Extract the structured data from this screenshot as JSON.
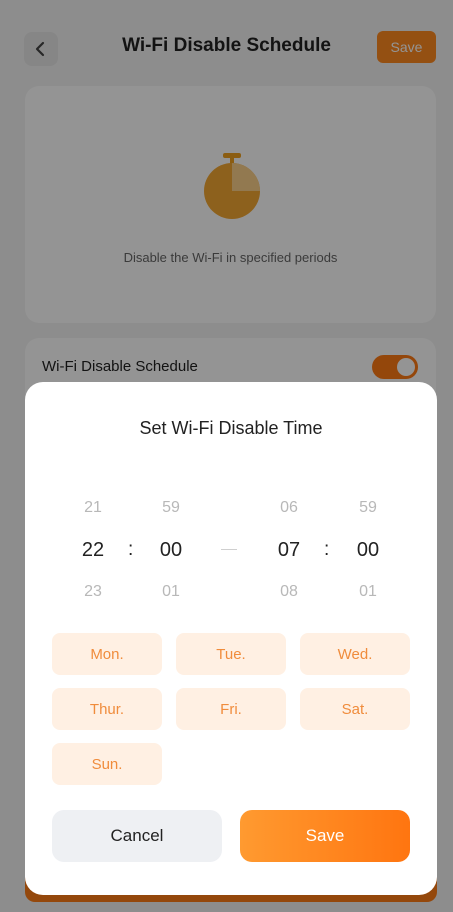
{
  "header": {
    "title": "Wi-Fi Disable Schedule",
    "save_label": "Save",
    "back_icon": "chevron-left-icon"
  },
  "hero": {
    "icon": "stopwatch-icon",
    "description": "Disable the Wi-Fi in specified periods"
  },
  "schedule_toggle": {
    "label": "Wi-Fi Disable Schedule",
    "enabled": true
  },
  "modal": {
    "title": "Set Wi-Fi Disable Time",
    "start": {
      "hour": {
        "prev": "21",
        "selected": "22",
        "next": "23"
      },
      "minute": {
        "prev": "59",
        "selected": "00",
        "next": "01"
      }
    },
    "end": {
      "hour": {
        "prev": "06",
        "selected": "07",
        "next": "08"
      },
      "minute": {
        "prev": "59",
        "selected": "00",
        "next": "01"
      }
    },
    "separator": ":",
    "days": [
      "Mon.",
      "Tue.",
      "Wed.",
      "Thur.",
      "Fri.",
      "Sat.",
      "Sun."
    ],
    "cancel_label": "Cancel",
    "save_label": "Save"
  },
  "colors": {
    "accent": "#ff7a14",
    "day_bg": "#fff0e3",
    "day_text": "#f08c3c"
  }
}
